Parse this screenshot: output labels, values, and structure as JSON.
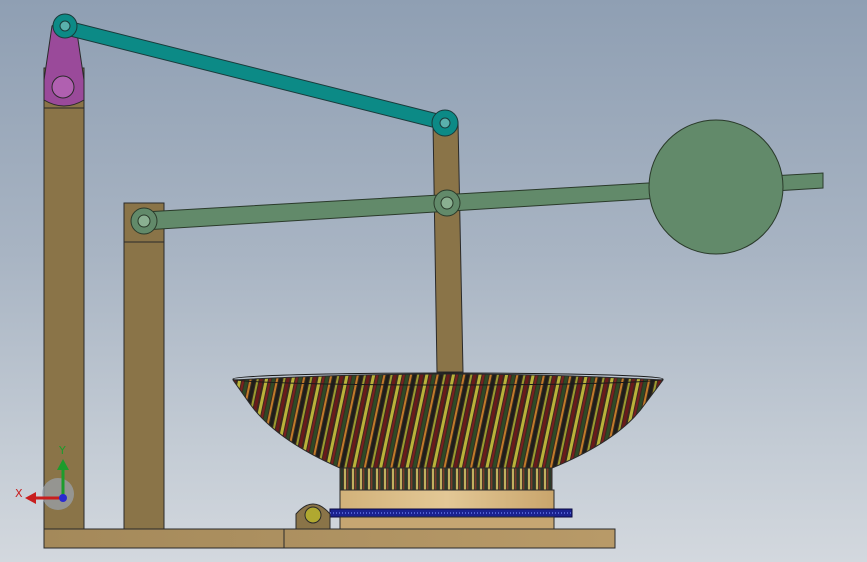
{
  "axes_triad": {
    "x_label": "X",
    "y_label": "Y",
    "colors": {
      "x": "#c81e1e",
      "y": "#1c9c2c",
      "z": "#2a2ad0"
    }
  },
  "colors": {
    "frame_wood": "#8a7448",
    "base_wood": "#a4895a",
    "top_link": "#0c8a86",
    "lever": "#628a6a",
    "counterweight": "#628a6a",
    "pivot_block": "#9a4a9a",
    "rack": "#1a2290",
    "outline": "#2a2a2a"
  },
  "parts": [
    "left-post",
    "middle-post",
    "vertical-rod",
    "top-link",
    "lever-arm",
    "counterweight-ball",
    "pivot-block",
    "patterned-bowl",
    "bowl-base",
    "gear-rack",
    "small-pinion",
    "base-plate"
  ]
}
